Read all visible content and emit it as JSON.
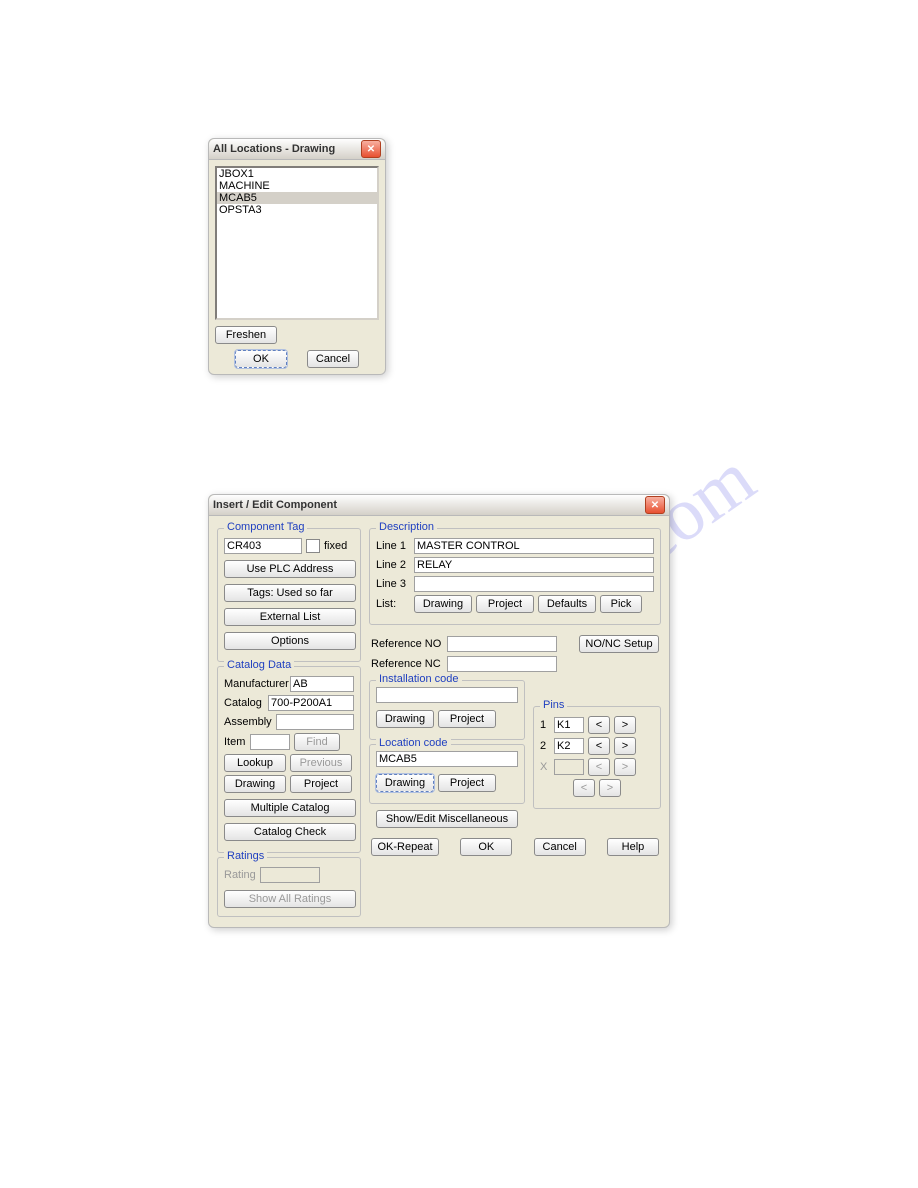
{
  "watermark": "manualshive.com",
  "dialog1": {
    "title": "All Locations - Drawing",
    "items": [
      "JBOX1",
      "MACHINE",
      "MCAB5",
      "OPSTA3"
    ],
    "selected_index": 2,
    "freshen": "Freshen",
    "ok": "OK",
    "cancel": "Cancel"
  },
  "dialog2": {
    "title": "Insert / Edit Component",
    "component_tag": {
      "legend": "Component Tag",
      "value": "CR403",
      "fixed_label": "fixed",
      "use_plc": "Use PLC Address",
      "tags_used": "Tags: Used so far",
      "external_list": "External List",
      "options": "Options"
    },
    "catalog_data": {
      "legend": "Catalog Data",
      "manufacturer_label": "Manufacturer",
      "manufacturer_value": "AB",
      "catalog_label": "Catalog",
      "catalog_value": "700-P200A1",
      "assembly_label": "Assembly",
      "assembly_value": "",
      "item_label": "Item",
      "item_value": "",
      "find": "Find",
      "lookup": "Lookup",
      "previous": "Previous",
      "drawing": "Drawing",
      "project": "Project",
      "multiple_catalog": "Multiple Catalog",
      "catalog_check": "Catalog Check"
    },
    "ratings": {
      "legend": "Ratings",
      "rating_label": "Rating",
      "rating_value": "",
      "show_all": "Show All Ratings"
    },
    "description": {
      "legend": "Description",
      "line1_label": "Line 1",
      "line1_value": "MASTER CONTROL",
      "line2_label": "Line 2",
      "line2_value": "RELAY",
      "line3_label": "Line 3",
      "line3_value": "",
      "list_label": "List:",
      "drawing": "Drawing",
      "project": "Project",
      "defaults": "Defaults",
      "pick": "Pick"
    },
    "reference": {
      "no_label": "Reference NO",
      "no_value": "",
      "nc_label": "Reference NC",
      "nc_value": "",
      "nonc_setup": "NO/NC Setup"
    },
    "installation_code": {
      "legend": "Installation code",
      "value": "",
      "drawing": "Drawing",
      "project": "Project"
    },
    "location_code": {
      "legend": "Location code",
      "value": "MCAB5",
      "drawing": "Drawing",
      "project": "Project"
    },
    "pins": {
      "legend": "Pins",
      "rows": [
        {
          "num": "1",
          "val": "K1"
        },
        {
          "num": "2",
          "val": "K2"
        }
      ],
      "x": "X",
      "left": "<",
      "right": ">"
    },
    "show_edit_misc": "Show/Edit Miscellaneous",
    "ok_repeat": "OK-Repeat",
    "ok": "OK",
    "cancel": "Cancel",
    "help": "Help"
  }
}
